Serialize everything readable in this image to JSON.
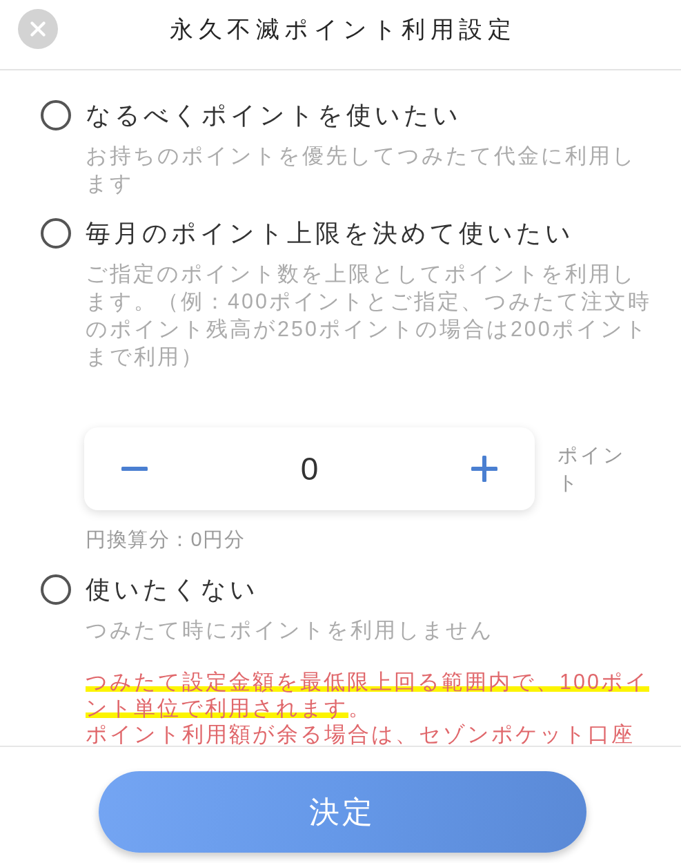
{
  "header": {
    "title": "永久不滅ポイント利用設定"
  },
  "options": [
    {
      "label": "なるべくポイントを使いたい",
      "description": "お持ちのポイントを優先してつみたて代金に利用します",
      "selected": false
    },
    {
      "label": "毎月のポイント上限を決めて使いたい",
      "description": "ご指定のポイント数を上限としてポイントを利用します。（例：400ポイントとご指定、つみたて注文時のポイント残高が250ポイントの場合は200ポイントまで利用）",
      "selected": false,
      "stepper": {
        "value": "0",
        "unit": "ポイント",
        "conversion": "円換算分：0円分"
      }
    },
    {
      "label": "使いたくない",
      "description": "つみたて時にポイントを利用しません",
      "selected": false
    }
  ],
  "notes": [
    {
      "segments": [
        {
          "text": "つみたて設定金額を最低限上回る範囲内で、100ポイント単位で利用されます",
          "highlighted": true
        },
        {
          "text": "。",
          "highlighted": false
        }
      ]
    },
    {
      "segments": [
        {
          "text": "ポイント利用額が余る場合は、セゾンポケット口座",
          "highlighted": false
        }
      ]
    }
  ],
  "confirm_button": {
    "label": "決定"
  }
}
